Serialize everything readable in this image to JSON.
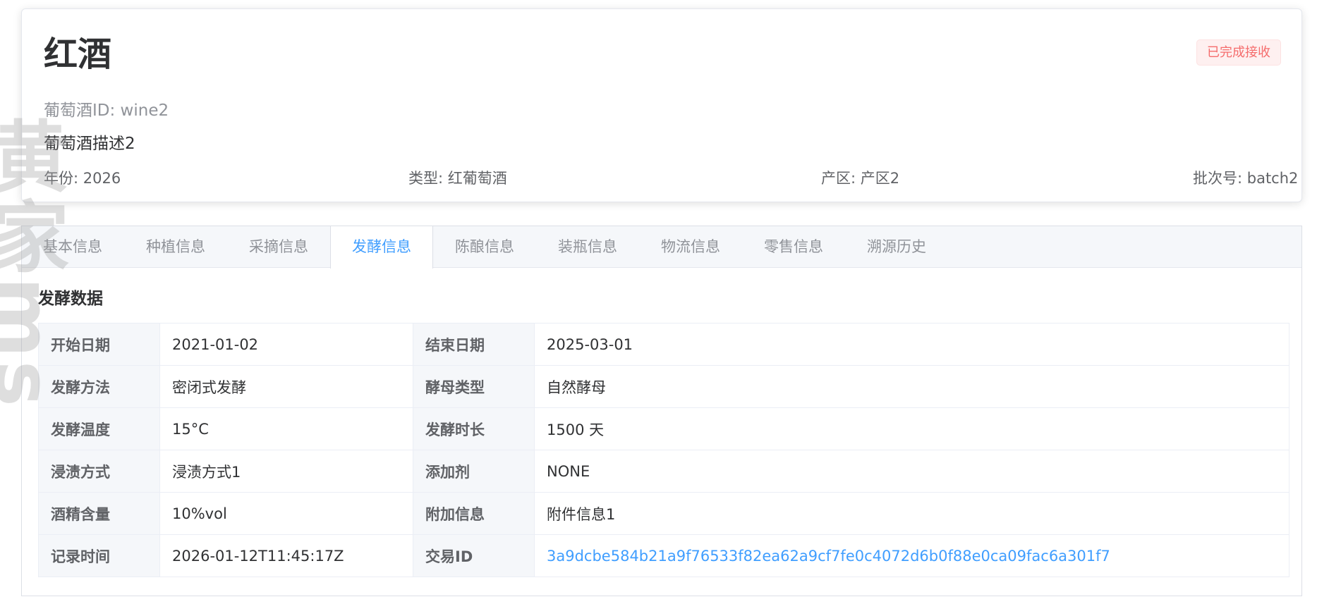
{
  "header": {
    "title": "红酒",
    "status": "已完成接收",
    "wine_id": "葡萄酒ID: wine2",
    "description": "葡萄酒描述2",
    "year": "年份: 2026",
    "type": "类型: 红葡萄酒",
    "origin": "产区: 产区2",
    "batch": "批次号: batch2"
  },
  "tabs": [
    {
      "label": "基本信息"
    },
    {
      "label": "种植信息"
    },
    {
      "label": "采摘信息"
    },
    {
      "label": "发酵信息",
      "active": true
    },
    {
      "label": "陈酿信息"
    },
    {
      "label": "装瓶信息"
    },
    {
      "label": "物流信息"
    },
    {
      "label": "零售信息"
    },
    {
      "label": "溯源历史"
    }
  ],
  "section": {
    "title": "发酵数据"
  },
  "fermentation": {
    "rows": [
      {
        "label1": "开始日期",
        "value1": "2021-01-02",
        "label2": "结束日期",
        "value2": "2025-03-01"
      },
      {
        "label1": "发酵方法",
        "value1": "密闭式发酵",
        "label2": "酵母类型",
        "value2": "自然酵母"
      },
      {
        "label1": "发酵温度",
        "value1": "15°C",
        "label2": "发酵时长",
        "value2": "1500 天"
      },
      {
        "label1": "浸渍方式",
        "value1": "浸渍方式1",
        "label2": "添加剂",
        "value2": "NONE"
      },
      {
        "label1": "酒精含量",
        "value1": "10%vol",
        "label2": "附加信息",
        "value2": "附件信息1"
      },
      {
        "label1": "记录时间",
        "value1": "2026-01-12T11:45:17Z",
        "label2": "交易ID",
        "value2": "3a9dcbe584b21a9f76533f82ea62a9cf7fe0c4072d6b0f88e0ca09fac6a301f7"
      }
    ]
  },
  "watermark": "黄家ms",
  "colors": {
    "accent": "#409eff",
    "status_text": "#f56c6c",
    "status_bg": "#fef0f0"
  }
}
